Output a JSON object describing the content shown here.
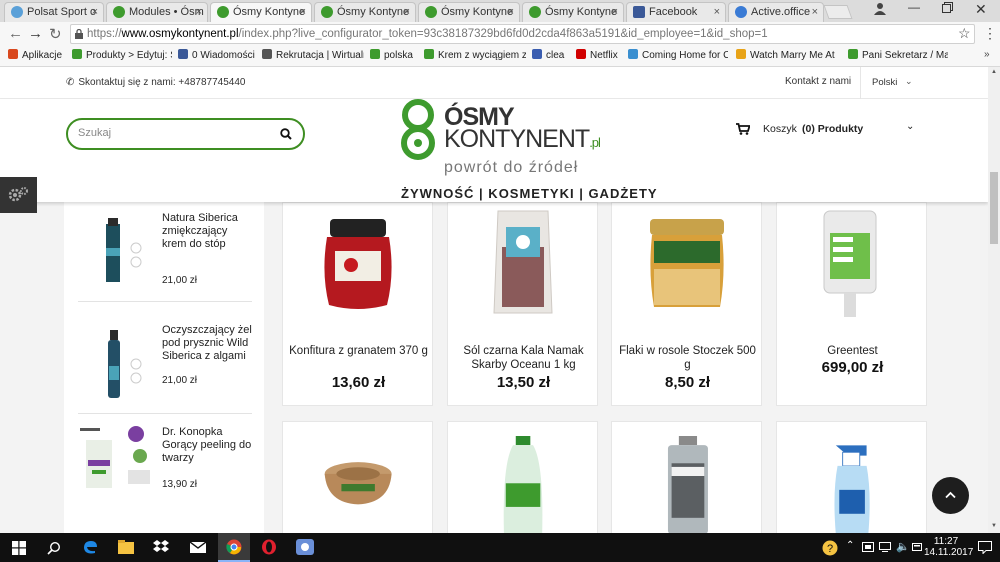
{
  "browser": {
    "tabs": [
      {
        "title": "Polsat Sport o",
        "color": "#5aa0d8"
      },
      {
        "title": "Modules • Ósm",
        "color": "#3e9b2e"
      },
      {
        "title": "Ósmy Kontyne",
        "color": "#3e9b2e",
        "active": true
      },
      {
        "title": "Ósmy Kontyne",
        "color": "#3e9b2e"
      },
      {
        "title": "Ósmy Kontyne",
        "color": "#3e9b2e"
      },
      {
        "title": "Ósmy Kontyne",
        "color": "#3e9b2e"
      },
      {
        "title": "Facebook",
        "color": "#3b5998"
      },
      {
        "title": "Active.office",
        "color": "#3a7bd5"
      }
    ],
    "tab_close": "×",
    "url_scheme": "https://",
    "url_host": "www.osmykontynent.pl",
    "url_rest": "/index.php?live_configurator_token=93c38187329bd6fd0d2cda4f863a5191&id_employee=1&id_shop=1",
    "bookmarks": [
      {
        "label": "Aplikacje",
        "color": "#d9481e"
      },
      {
        "label": "Produkty > Edytuj: Sc",
        "color": "#3e9b2e"
      },
      {
        "label": "0 Wiadomości",
        "color": "#3b5998"
      },
      {
        "label": "Rekrutacja | Wirtualn",
        "color": "#555555"
      },
      {
        "label": "polska",
        "color": "#3e9b2e"
      },
      {
        "label": "Krem z wyciągiem z p",
        "color": "#3e9b2e"
      },
      {
        "label": "clea",
        "color": "#3a5db0"
      },
      {
        "label": "Netflix",
        "color": "#d10000"
      },
      {
        "label": "Coming Home for Ch",
        "color": "#3a8fd0"
      },
      {
        "label": "Watch Marry Me At C",
        "color": "#e8a317"
      },
      {
        "label": "Pani Sekretarz / Madi",
        "color": "#3e9b2e"
      }
    ]
  },
  "site": {
    "contact": "Skontaktuj się z nami: +48787745440",
    "contact_link": "Kontakt z nami",
    "language": "Polski",
    "search_placeholder": "Szukaj",
    "logo_line1": "ÓSMY",
    "logo_line2": "KONTYNENT",
    "logo_tld": ".pl",
    "logo_tagline": "powrót do źródeł",
    "categories": "ŻYWNOŚĆ | KOSMETYKI | GADŻETY",
    "cart_label": "Koszyk",
    "cart_count": "(0) Produkty"
  },
  "sidebar": {
    "items": [
      {
        "name": "Natura Siberica zmiękczający krem do stóp",
        "price": "21,00 zł"
      },
      {
        "name": "Oczyszczający żel pod prysznic Wild Siberica z algami",
        "price": "21,00 zł"
      },
      {
        "name": "Dr. Konopka Gorący peeling do twarzy",
        "price": "13,90 zł"
      }
    ]
  },
  "products": [
    {
      "name": "Konfitura z granatem 370 g",
      "price": "13,60 zł"
    },
    {
      "name": "Sól czarna Kala Namak Skarby Oceanu 1 kg",
      "price": "13,50 zł"
    },
    {
      "name": "Flaki w rosole Stoczek 500 g",
      "price": "8,50 zł"
    },
    {
      "name": "Greentest",
      "price": "699,00 zł"
    }
  ],
  "taskbar": {
    "time": "11:27",
    "date": "14.11.2017"
  }
}
